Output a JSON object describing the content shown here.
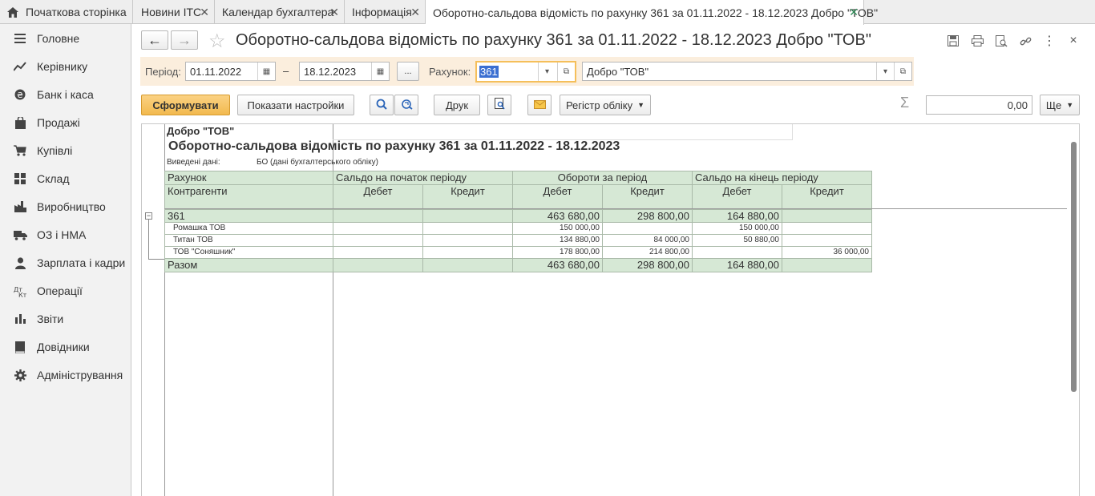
{
  "tabs": [
    {
      "label": "Початкова сторінка"
    },
    {
      "label": "Новини ІТС"
    },
    {
      "label": "Календар бухгалтера"
    },
    {
      "label": "Інформація"
    },
    {
      "label": "Оборотно-сальдова відомість по рахунку 361 за 01.11.2022 - 18.12.2023 Добро \"ТОВ\""
    }
  ],
  "sidebar": {
    "items": [
      {
        "label": "Головне",
        "icon": "menu-icon"
      },
      {
        "label": "Керівнику",
        "icon": "trend-icon"
      },
      {
        "label": "Банк і каса",
        "icon": "coin-icon"
      },
      {
        "label": "Продажі",
        "icon": "bag-icon"
      },
      {
        "label": "Купівлі",
        "icon": "cart-icon"
      },
      {
        "label": "Склад",
        "icon": "grid-icon"
      },
      {
        "label": "Виробництво",
        "icon": "factory-icon"
      },
      {
        "label": "ОЗ і НМА",
        "icon": "truck-icon"
      },
      {
        "label": "Зарплата і кадри",
        "icon": "person-icon"
      },
      {
        "label": "Операції",
        "icon": "dtkt-icon"
      },
      {
        "label": "Звіти",
        "icon": "bar-chart-icon"
      },
      {
        "label": "Довідники",
        "icon": "book-icon"
      },
      {
        "label": "Адміністрування",
        "icon": "gear-icon"
      }
    ]
  },
  "header": {
    "title": "Оборотно-сальдова відомість по рахунку 361 за 01.11.2022 - 18.12.2023 Добро \"ТОВ\"",
    "back": "←",
    "forward": "→",
    "close": "×"
  },
  "params": {
    "period_label": "Період:",
    "date_from": "01.11.2022",
    "dash": "–",
    "date_to": "18.12.2023",
    "dots": "...",
    "account_label": "Рахунок:",
    "account": "361",
    "organization": "Добро \"ТОВ\""
  },
  "toolbar": {
    "generate": "Сформувати",
    "show_settings": "Показати настройки",
    "print": "Друк",
    "register": "Регістр обліку",
    "sum_symbol": "Σ",
    "sum_value": "0,00",
    "more": "Ще"
  },
  "report": {
    "org": "Добро \"ТОВ\"",
    "title": "Оборотно-сальдова відомість по рахунку 361 за 01.11.2022 - 18.12.2023",
    "data_label": "Виведені дані:",
    "data_value": "БО (дані бухгалтерського обліку)",
    "col_account": "Рахунок",
    "col_contragents": "Контрагенти",
    "group_start": "Сальдо на початок періоду",
    "group_turnover": "Обороти за період",
    "group_end": "Сальдо на кінець періоду",
    "debit": "Дебет",
    "credit": "Кредит",
    "rows": [
      {
        "name": "361",
        "sd": "",
        "sc": "",
        "td": "463 680,00",
        "tc": "298 800,00",
        "ed": "164 880,00",
        "ec": ""
      },
      {
        "name": "Ромашка ТОВ",
        "sd": "",
        "sc": "",
        "td": "150 000,00",
        "tc": "",
        "ed": "150 000,00",
        "ec": ""
      },
      {
        "name": "Титан ТОВ",
        "sd": "",
        "sc": "",
        "td": "134 880,00",
        "tc": "84 000,00",
        "ed": "50 880,00",
        "ec": ""
      },
      {
        "name": "ТОВ \"Соняшник\"",
        "sd": "",
        "sc": "",
        "td": "178 800,00",
        "tc": "214 800,00",
        "ed": "",
        "ec": "36 000,00"
      }
    ],
    "total": {
      "name": "Разом",
      "sd": "",
      "sc": "",
      "td": "463 680,00",
      "tc": "298 800,00",
      "ed": "164 880,00",
      "ec": ""
    }
  },
  "colors": {
    "accent": "#f5bf5a",
    "header_green": "#d6e8d5",
    "sidebar_bg": "#f2f2f2"
  }
}
